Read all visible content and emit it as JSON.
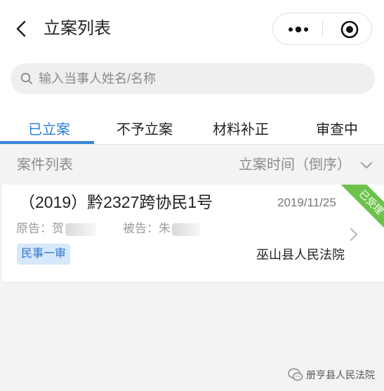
{
  "header": {
    "title": "立案列表",
    "back_icon": "chevron-left-icon",
    "more_icon": "more-dots-icon",
    "target_icon": "target-icon"
  },
  "search": {
    "placeholder": "输入当事人姓名/名称",
    "icon": "search-icon"
  },
  "tabs": [
    {
      "label": "已立案",
      "active": true
    },
    {
      "label": "不予立案",
      "active": false
    },
    {
      "label": "材料补正",
      "active": false
    },
    {
      "label": "审查中",
      "active": false
    }
  ],
  "list_header": {
    "title": "案件列表",
    "sort_label": "立案时间（倒序）"
  },
  "cases": [
    {
      "number": "（2019）黔2327跨协民1号",
      "date": "2019/11/25",
      "plaintiff_label": "原告：贺",
      "defendant_label": "被告：朱",
      "type": "民事一审",
      "court": "巫山县人民法院",
      "status": "已受理"
    }
  ],
  "watermark": {
    "text": "册亨县人民法院"
  },
  "colors": {
    "accent": "#3585d8",
    "status_green": "#6cc24a",
    "badge_bg": "#d6e8fa"
  }
}
